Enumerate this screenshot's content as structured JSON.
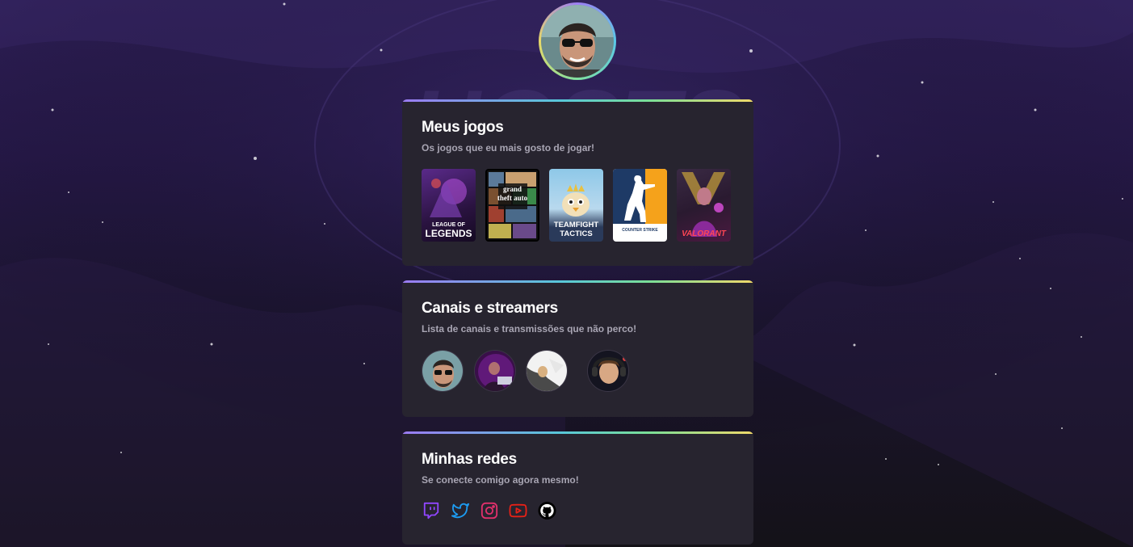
{
  "profile": {
    "avatar_alt": "profile-photo"
  },
  "sections": {
    "games": {
      "title": "Meus jogos",
      "subtitle": "Os jogos que eu mais gosto de jogar!",
      "items": [
        {
          "line1": "LEAGUE OF",
          "line2": "LEGENDS",
          "icon": "league-of-legends"
        },
        {
          "line1": "grand",
          "line2": "theft auto",
          "icon": "gta-v"
        },
        {
          "line1": "TEAMFIGHT",
          "line2": "TACTICS",
          "icon": "teamfight-tactics"
        },
        {
          "line1": "COUNTER STRIKE",
          "line2": "",
          "icon": "counter-strike"
        },
        {
          "line1": "VALORANT",
          "line2": "",
          "icon": "valorant"
        }
      ]
    },
    "streamers": {
      "title": "Canais e streamers",
      "subtitle": "Lista de canais e transmissões que não perco!"
    },
    "socials": {
      "title": "Minhas redes",
      "subtitle": "Se conecte comigo agora mesmo!",
      "items": [
        {
          "icon": "twitch-icon",
          "color": "#9146ff"
        },
        {
          "icon": "twitter-icon",
          "color": "#1d9bf0"
        },
        {
          "icon": "instagram-icon",
          "color": "#e1306c"
        },
        {
          "icon": "youtube-icon",
          "color": "#e62117"
        },
        {
          "icon": "github-icon",
          "color": "#000000"
        }
      ]
    }
  }
}
